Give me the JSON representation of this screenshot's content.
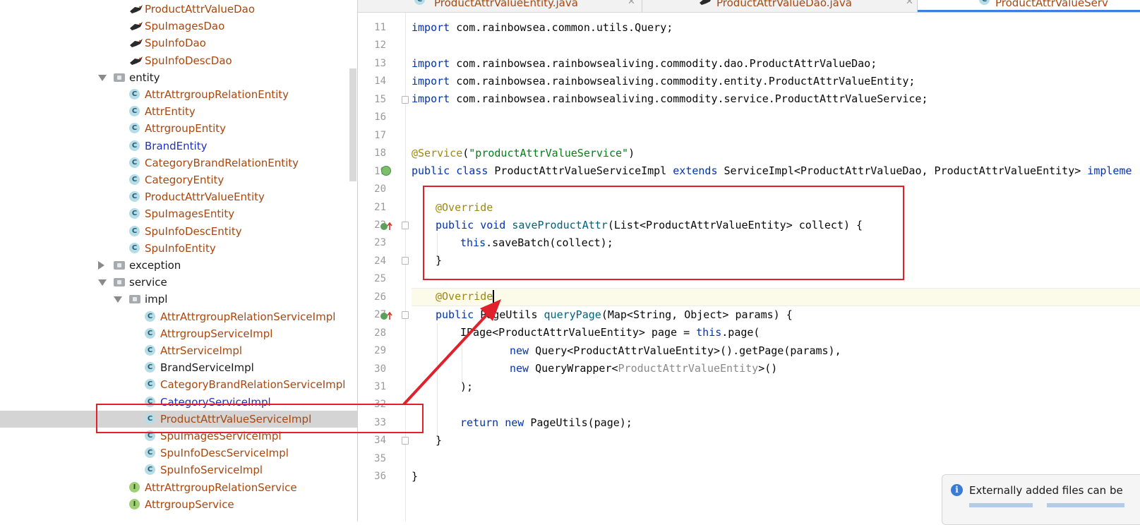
{
  "colors": {
    "class_brown": "#a9470f",
    "class_blue": "#2133b8",
    "keyword": "#0033b3",
    "annotation": "#9e880d",
    "string": "#067d17",
    "highlight": "#e0202a",
    "tab_underline": "#3d7fe0"
  },
  "tabs": [
    {
      "label": "ProductAttrValueEntity.java",
      "icon": "class-icon"
    },
    {
      "label": "ProductAttrValueDao.java",
      "icon": "bird-icon"
    },
    {
      "label": "ProductAttrValueServ",
      "icon": "class-icon"
    }
  ],
  "tree": {
    "items": [
      {
        "label": "ProductAttrValueDao",
        "icon": "bird-icon"
      },
      {
        "label": "SpuImagesDao",
        "icon": "bird-icon"
      },
      {
        "label": "SpuInfoDao",
        "icon": "bird-icon"
      },
      {
        "label": "SpuInfoDescDao",
        "icon": "bird-icon"
      },
      {
        "label": "entity",
        "icon": "package-icon"
      },
      {
        "label": "AttrAttrgroupRelationEntity",
        "icon": "class-icon"
      },
      {
        "label": "AttrEntity",
        "icon": "class-icon"
      },
      {
        "label": "AttrgroupEntity",
        "icon": "class-icon"
      },
      {
        "label": "BrandEntity",
        "icon": "class-icon"
      },
      {
        "label": "CategoryBrandRelationEntity",
        "icon": "class-icon"
      },
      {
        "label": "CategoryEntity",
        "icon": "class-icon"
      },
      {
        "label": "ProductAttrValueEntity",
        "icon": "class-icon"
      },
      {
        "label": "SpuImagesEntity",
        "icon": "class-icon"
      },
      {
        "label": "SpuInfoDescEntity",
        "icon": "class-icon"
      },
      {
        "label": "SpuInfoEntity",
        "icon": "class-icon"
      },
      {
        "label": "exception",
        "icon": "package-icon"
      },
      {
        "label": "service",
        "icon": "package-icon"
      },
      {
        "label": "impl",
        "icon": "package-icon"
      },
      {
        "label": "AttrAttrgroupRelationServiceImpl",
        "icon": "class-icon"
      },
      {
        "label": "AttrgroupServiceImpl",
        "icon": "class-icon"
      },
      {
        "label": "AttrServiceImpl",
        "icon": "class-icon"
      },
      {
        "label": "BrandServiceImpl",
        "icon": "class-icon"
      },
      {
        "label": "CategoryBrandRelationServiceImpl",
        "icon": "class-icon"
      },
      {
        "label": "CategoryServiceImpl",
        "icon": "class-icon"
      },
      {
        "label": "ProductAttrValueServiceImpl",
        "icon": "class-icon"
      },
      {
        "label": "SpuImagesServiceImpl",
        "icon": "class-icon"
      },
      {
        "label": "SpuInfoDescServiceImpl",
        "icon": "class-icon"
      },
      {
        "label": "SpuInfoServiceImpl",
        "icon": "class-icon"
      },
      {
        "label": "AttrAttrgroupRelationService",
        "icon": "interface-icon"
      },
      {
        "label": "AttrgroupService",
        "icon": "interface-icon"
      }
    ]
  },
  "editor": {
    "line_numbers": [
      "11",
      "12",
      "13",
      "14",
      "15",
      "16",
      "17",
      "18",
      "19",
      "20",
      "21",
      "22",
      "23",
      "24",
      "25",
      "26",
      "27",
      "28",
      "29",
      "30",
      "31",
      "32",
      "33",
      "34",
      "35",
      "36"
    ],
    "code": {
      "l11": {
        "kw": "import",
        "rest": " com.rainbowsea.common.utils.Query;"
      },
      "l13": {
        "kw": "import",
        "rest": " com.rainbowsea.rainbowsealiving.commodity.dao.ProductAttrValueDao;"
      },
      "l14": {
        "kw": "import",
        "rest": " com.rainbowsea.rainbowsealiving.commodity.entity.ProductAttrValueEntity;"
      },
      "l15": {
        "kw": "import",
        "rest": " com.rainbowsea.rainbowsealiving.commodity.service.ProductAttrValueService;"
      },
      "l18": {
        "an": "@Service",
        "p1": "(",
        "str": "\"productAttrValueService\"",
        "p2": ")"
      },
      "l19": {
        "kw1": "public class",
        "t1": " ProductAttrValueServiceImpl ",
        "kw2": "extends",
        "t2": " ServiceImpl<ProductAttrValueDao, ProductAttrValueEntity> ",
        "kw3": "impleme"
      },
      "l21": {
        "an": "@Override"
      },
      "l22": {
        "kw": "public void",
        "sp": " ",
        "fn": "saveProductAttr",
        "rest": "(List<ProductAttrValueEntity> collect) {"
      },
      "l23": {
        "kw": "this",
        "rest": ".saveBatch(collect);"
      },
      "l24": {
        "text": "}"
      },
      "l26": {
        "an": "@Override"
      },
      "l27": {
        "kw": "public",
        "t1": " PageUtils ",
        "fn": "queryPage",
        "rest": "(Map<String, Object> params) {"
      },
      "l28": {
        "t1": "IPage<ProductAttrValueEntity> page = ",
        "kw": "this",
        "rest": ".page("
      },
      "l29": {
        "kw": "new",
        "rest": " Query<ProductAttrValueEntity>().getPage(params),"
      },
      "l30": {
        "kw": "new",
        "t1": " QueryWrapper<",
        "gray": "ProductAttrValueEntity",
        "rest": ">()"
      },
      "l31": {
        "text": ");"
      },
      "l33": {
        "kw1": "return",
        "sp": " ",
        "kw2": "new",
        "rest": " PageUtils(page);"
      },
      "l34": {
        "text": "}"
      },
      "l36": {
        "text": "}"
      }
    }
  },
  "notification": {
    "text": "Externally added files can be",
    "icon": "info-icon"
  }
}
